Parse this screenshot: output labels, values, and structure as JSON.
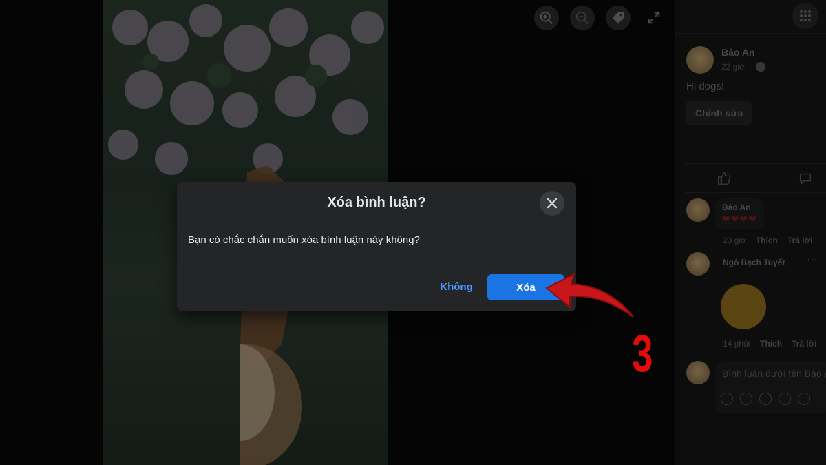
{
  "dialog": {
    "title": "Xóa bình luận?",
    "message": "Bạn có chắc chắn muốn xóa bình luận này không?",
    "cancel_label": "Không",
    "confirm_label": "Xóa"
  },
  "annotation": {
    "step": "3",
    "color": "#e40b0b"
  },
  "viewer": {
    "tools": [
      "zoom-in-icon",
      "zoom-out-icon",
      "tag-icon",
      "fullscreen-icon"
    ]
  },
  "panel": {
    "post": {
      "author": "Bảo An",
      "time": "22 giờ",
      "text": "Hi dogs!",
      "edit_label": "Chỉnh sửa"
    },
    "comments": [
      {
        "name": "Bảo An",
        "content": "❤❤❤❤",
        "time": "23 giờ",
        "like": "Thích",
        "reply": "Trả lời"
      },
      {
        "name": "Ngô Bạch Tuyết",
        "time": "14 phút",
        "like": "Thích",
        "reply": "Trả lời"
      }
    ],
    "comment_placeholder": "Bình luận dưới tên Bảo An"
  },
  "colors": {
    "primary": "#1b74e4",
    "link": "#4599ff",
    "dialog_bg": "#242526"
  }
}
